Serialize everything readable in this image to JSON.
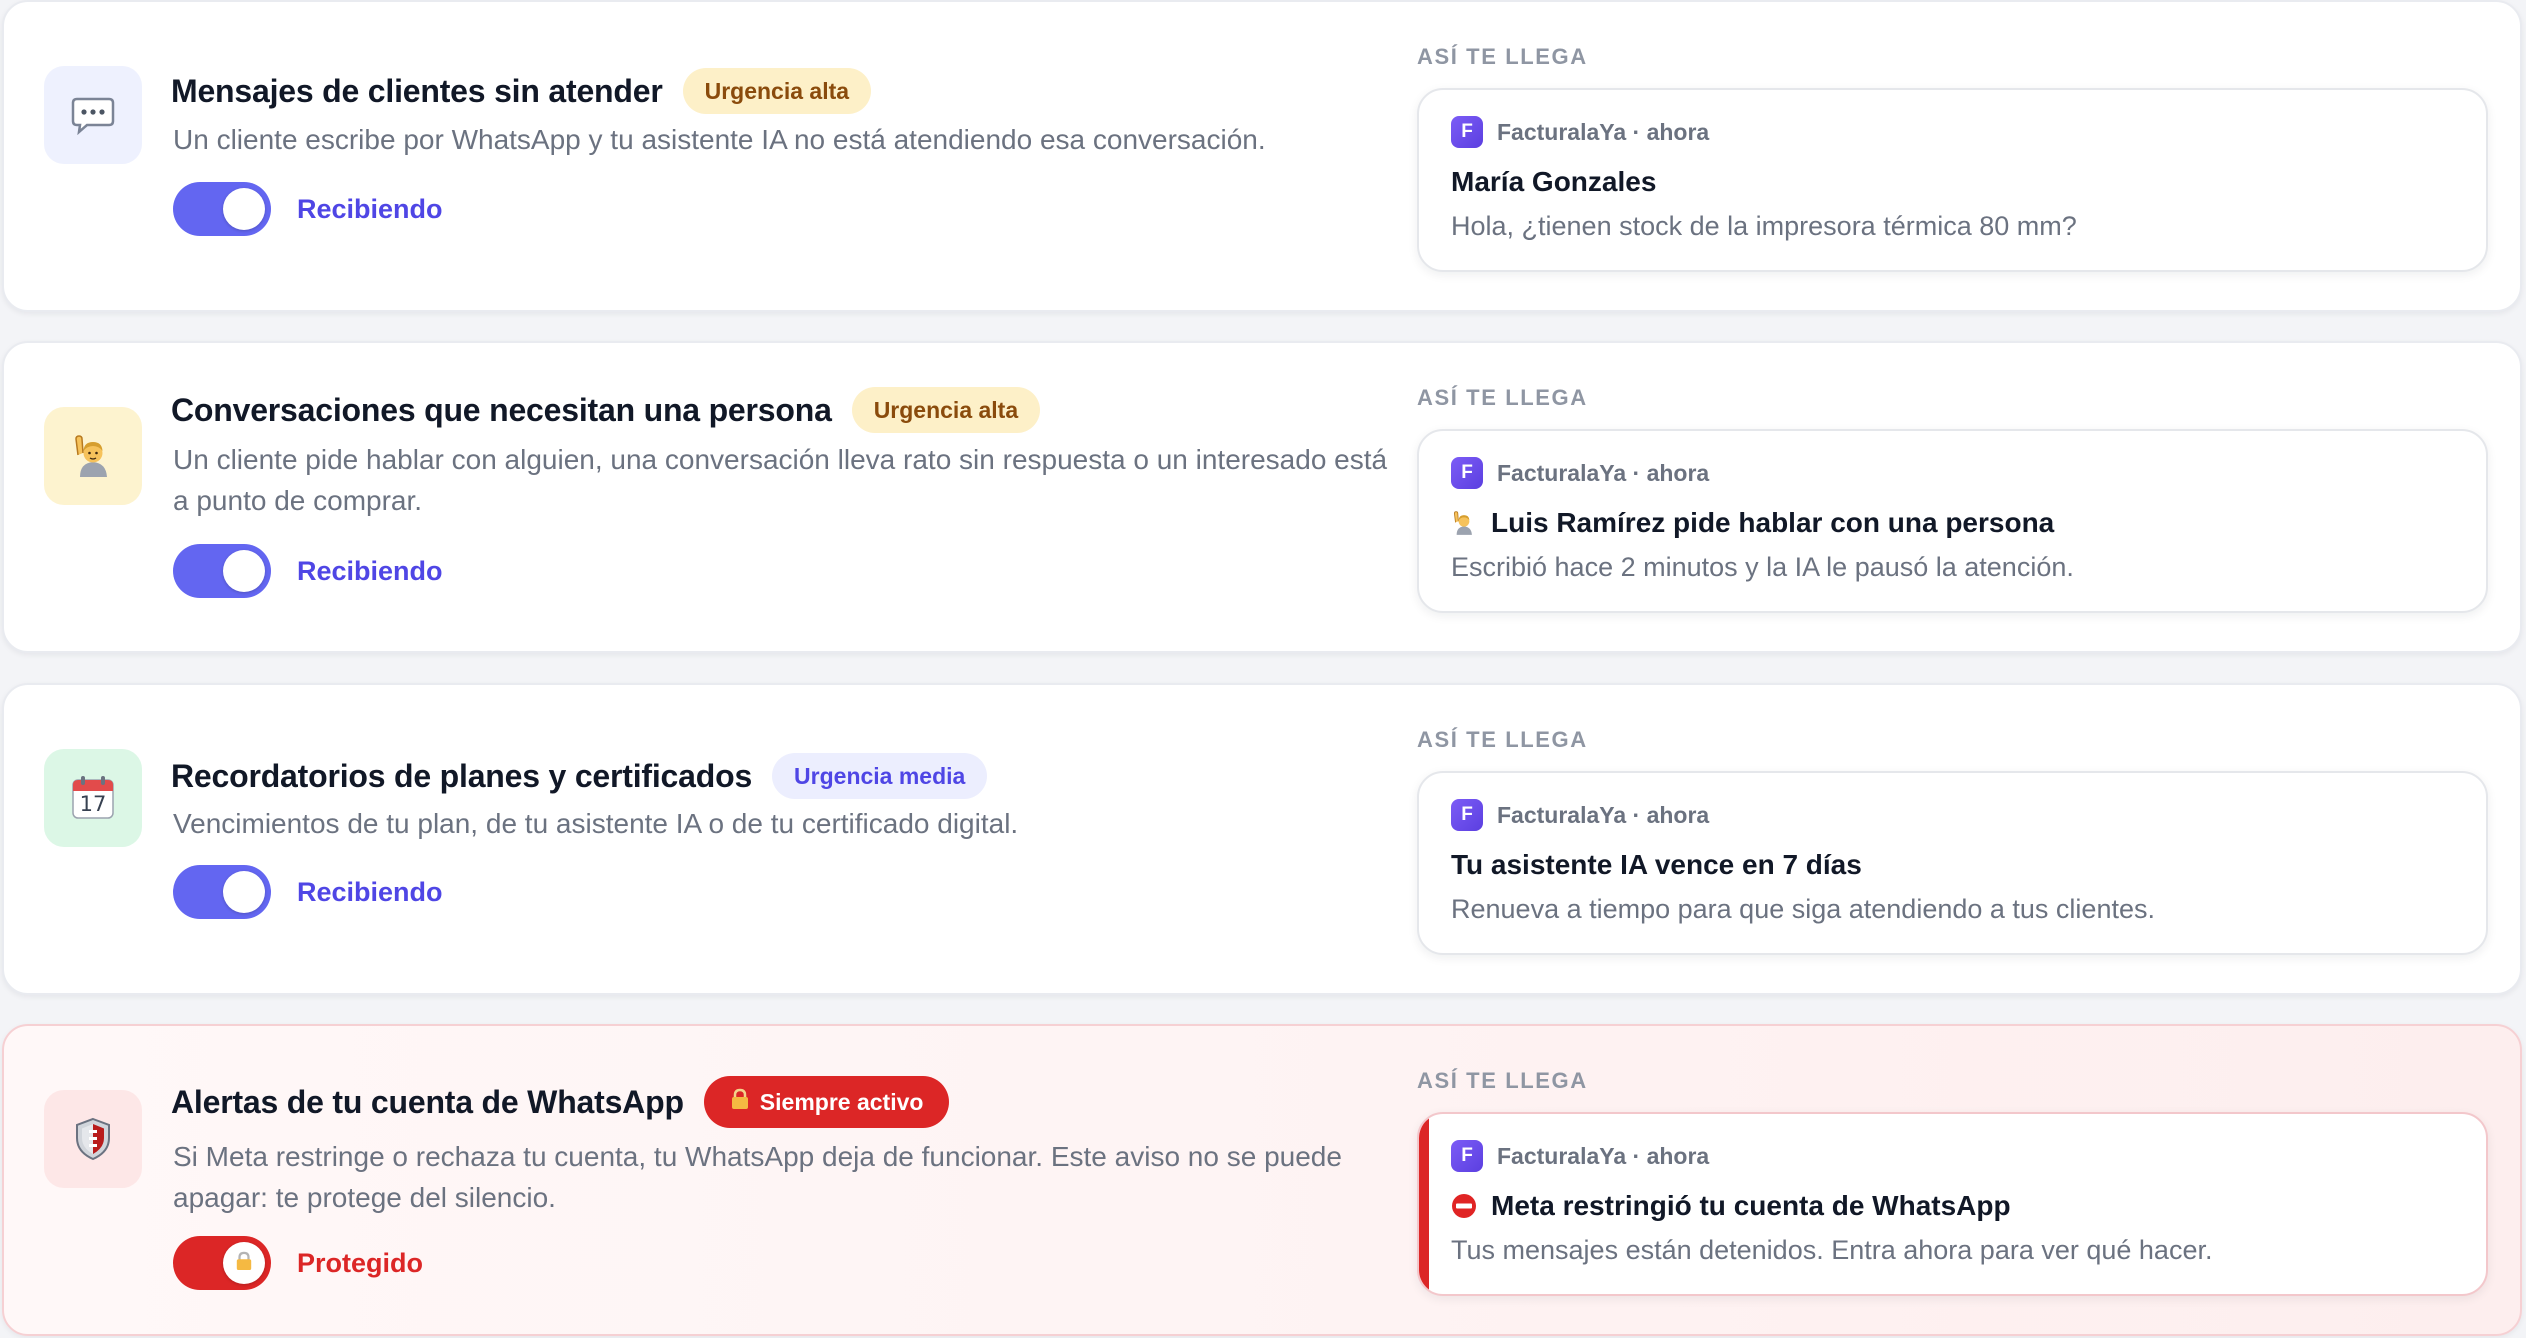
{
  "preview_heading": "ASÍ TE LLEGA",
  "cards": [
    {
      "icon": "speech-bubble-icon",
      "title": "Mensajes de clientes sin atender",
      "badge": "Urgencia alta",
      "description": "Un cliente escribe por WhatsApp y tu asistente IA no está atendiendo esa conversación.",
      "toggle_label": "Recibiendo",
      "toggle_on": true,
      "notification": {
        "app": "FacturalaYa · ahora",
        "app_initial": "F",
        "title": "María Gonzales",
        "body": "Hola, ¿tienen stock de la impresora térmica 80 mm?"
      }
    },
    {
      "icon": "person-raising-hand-icon",
      "title": "Conversaciones que necesitan una persona",
      "badge": "Urgencia alta",
      "description": "Un cliente pide hablar con alguien, una conversación lleva rato sin respuesta o un interesado está a punto de comprar.",
      "toggle_label": "Recibiendo",
      "toggle_on": true,
      "notification": {
        "app": "FacturalaYa · ahora",
        "app_initial": "F",
        "title": "Luis Ramírez pide hablar con una persona",
        "title_icon": "person-raising-hand-icon",
        "body": "Escribió hace 2 minutos y la IA le pausó la atención."
      }
    },
    {
      "icon": "calendar-icon",
      "icon_text": "17",
      "title": "Recordatorios de planes y certificados",
      "badge": "Urgencia media",
      "description": "Vencimientos de tu plan, de tu asistente IA o de tu certificado digital.",
      "toggle_label": "Recibiendo",
      "toggle_on": true,
      "notification": {
        "app": "FacturalaYa · ahora",
        "app_initial": "F",
        "title": "Tu asistente IA vence en 7 días",
        "body": "Renueva a tiempo para que siga atendiendo a tus clientes."
      }
    },
    {
      "icon": "shield-icon",
      "title": "Alertas de tu cuenta de WhatsApp",
      "badge": "Siempre activo",
      "badge_icon": "lock-icon",
      "description": "Si Meta restringe o rechaza tu cuenta, tu WhatsApp deja de funcionar. Este aviso no se puede apagar: te protege del silencio.",
      "toggle_label": "Protegido",
      "toggle_on": true,
      "toggle_locked": true,
      "notification": {
        "app": "FacturalaYa · ahora",
        "app_initial": "F",
        "title": "Meta restringió tu cuenta de WhatsApp",
        "title_icon": "no-entry-icon",
        "body": "Tus mensajes están detenidos. Entra ahora para ver qué hacer."
      }
    }
  ],
  "colors": {
    "accent": "#6366f1",
    "accent_text": "#4f46e5",
    "danger": "#dc2626",
    "badge_high_bg": "#fdf0c8",
    "badge_high_text": "#8a4b0c",
    "badge_medium_bg": "#eceefe"
  }
}
